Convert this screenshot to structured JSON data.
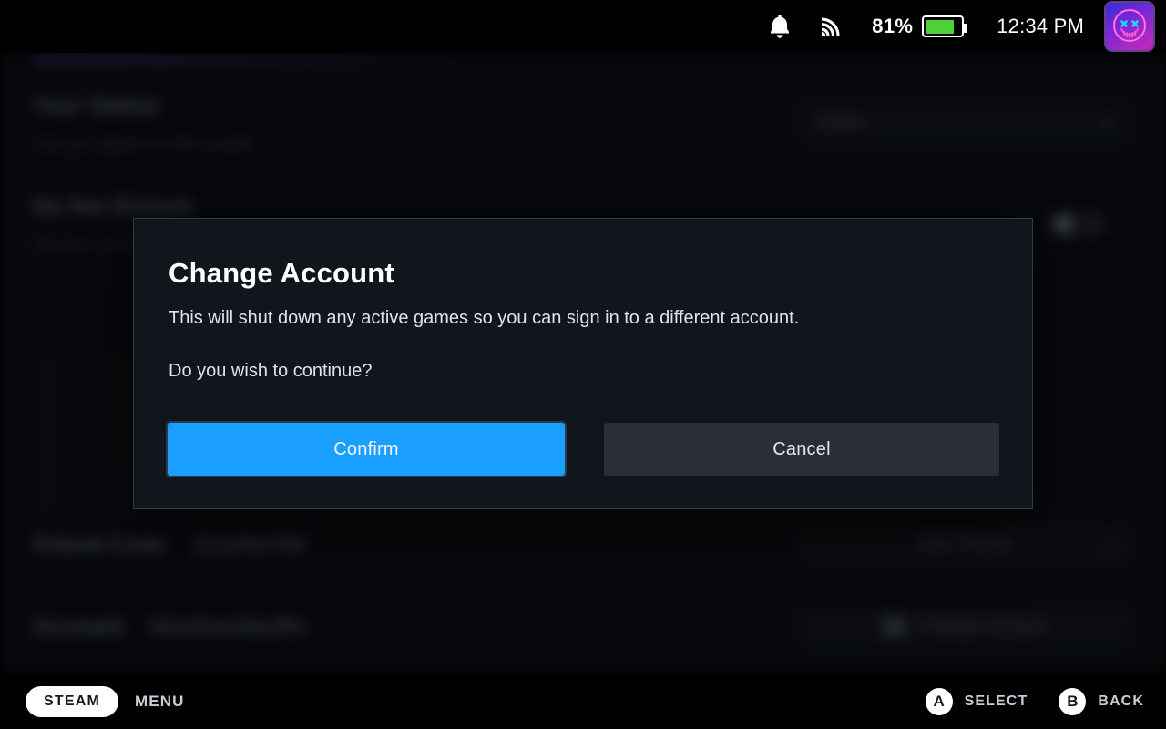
{
  "statusbar": {
    "notification_icon": "bell-icon",
    "wifi_icon": "wifi-icon",
    "battery_percent": "81%",
    "battery_level": 81,
    "battery_fill_color": "#4cd137",
    "clock": "12:34 PM",
    "avatar_icon": "neon-smiley-avatar"
  },
  "background": {
    "status_label": "Your Status",
    "status_sub": "How you appear to other people",
    "status_value": "Online",
    "dnd_label": "Do Not Disturb",
    "dnd_sub": "Disables all notifications",
    "friend_code_label": "Friend Code",
    "friend_code_value": "213456789",
    "add_friends_label": "Add Friends",
    "account_label": "Account",
    "account_value": "bioshockbuffs",
    "change_account_label": "Change Account"
  },
  "dialog": {
    "title": "Change Account",
    "line1": "This will shut down any active games so you can sign in to a different account.",
    "line2": "Do you wish to continue?",
    "confirm_label": "Confirm",
    "cancel_label": "Cancel",
    "confirm_color": "#1a9fff",
    "cancel_color": "#2a2e39"
  },
  "footer": {
    "steam_label": "STEAM",
    "menu_label": "MENU",
    "a_button": "A",
    "select_label": "SELECT",
    "b_button": "B",
    "back_label": "BACK"
  }
}
